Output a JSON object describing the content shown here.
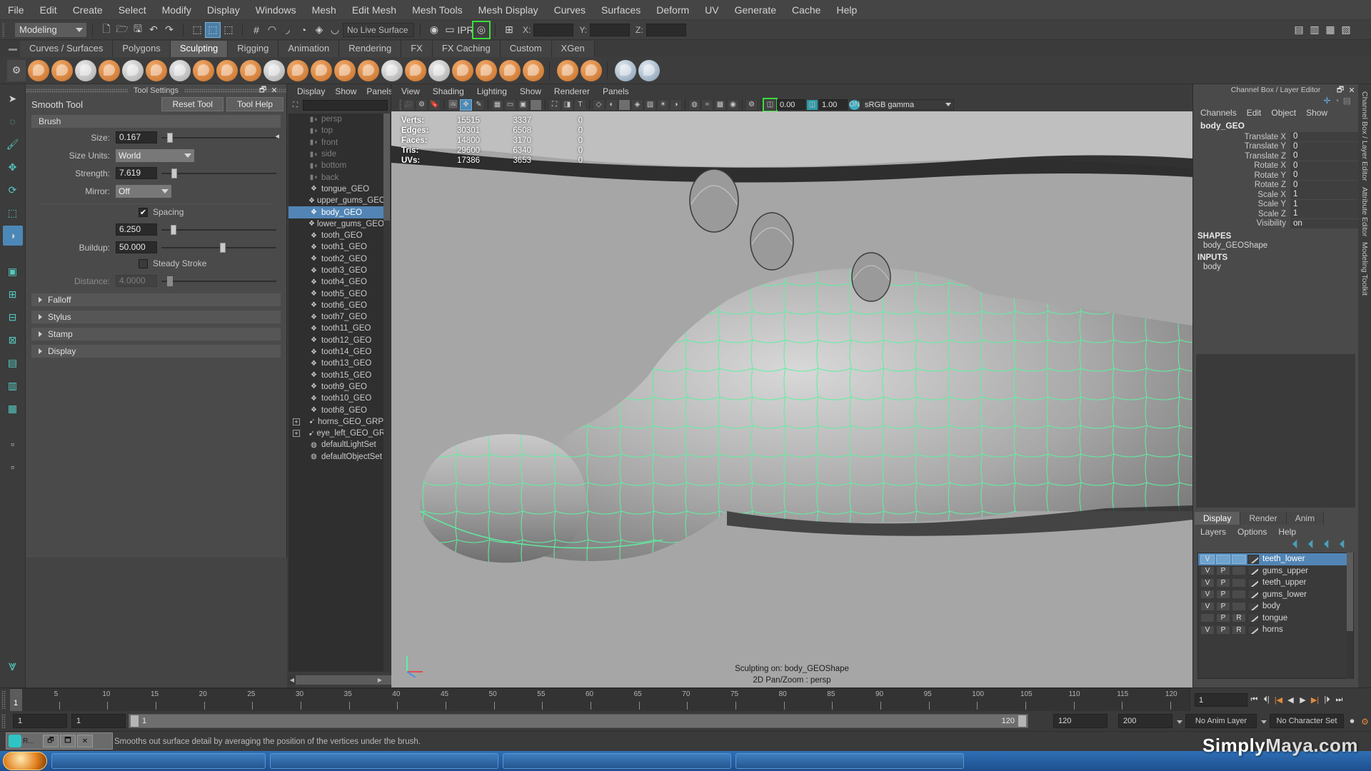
{
  "menubar": {
    "items": [
      "File",
      "Edit",
      "Create",
      "Select",
      "Modify",
      "Display",
      "Windows",
      "Mesh",
      "Edit Mesh",
      "Mesh Tools",
      "Mesh Display",
      "Curves",
      "Surfaces",
      "Deform",
      "UV",
      "Generate",
      "Cache",
      "Help"
    ]
  },
  "statusline": {
    "menuset": "Modeling",
    "live_surface": "No Live Surface",
    "coord_x_label": "X:",
    "coord_y_label": "Y:",
    "coord_z_label": "Z:"
  },
  "shelf": {
    "tabs": [
      "Curves / Surfaces",
      "Polygons",
      "Sculpting",
      "Rigging",
      "Animation",
      "Rendering",
      "FX",
      "FX Caching",
      "Custom",
      "XGen"
    ],
    "active_tab": "Sculpting"
  },
  "tool_settings": {
    "panel_title": "Tool Settings",
    "tool_name": "Smooth Tool",
    "reset_label": "Reset Tool",
    "help_label": "Tool Help",
    "brush_section": "Brush",
    "size_label": "Size:",
    "size_value": "0.167",
    "size_units_label": "Size Units:",
    "size_units_value": "World",
    "strength_label": "Strength:",
    "strength_value": "7.619",
    "mirror_label": "Mirror:",
    "mirror_value": "Off",
    "spacing_label": "Spacing",
    "spacing_checked": true,
    "spacing_value": "6.250",
    "buildup_label": "Buildup:",
    "buildup_value": "50.000",
    "steady_stroke_label": "Steady Stroke",
    "steady_stroke_checked": false,
    "distance_label": "Distance:",
    "distance_value": "4.0000",
    "collapsed_sections": [
      "Falloff",
      "Stylus",
      "Stamp",
      "Display"
    ]
  },
  "outliner": {
    "menu": [
      "Display",
      "Show",
      "Panels"
    ],
    "items": [
      {
        "label": "persp",
        "icon": "camera-icon",
        "dim": true,
        "plus": false
      },
      {
        "label": "top",
        "icon": "camera-icon",
        "dim": true,
        "plus": false
      },
      {
        "label": "front",
        "icon": "camera-icon",
        "dim": true,
        "plus": false
      },
      {
        "label": "side",
        "icon": "camera-icon",
        "dim": true,
        "plus": false
      },
      {
        "label": "bottom",
        "icon": "camera-icon",
        "dim": true,
        "plus": false
      },
      {
        "label": "back",
        "icon": "camera-icon",
        "dim": true,
        "plus": false
      },
      {
        "label": "tongue_GEO",
        "icon": "mesh-icon",
        "dim": false,
        "plus": false
      },
      {
        "label": "upper_gums_GEO",
        "icon": "mesh-icon",
        "dim": false,
        "plus": false
      },
      {
        "label": "body_GEO",
        "icon": "mesh-icon",
        "dim": false,
        "plus": false,
        "selected": true
      },
      {
        "label": "lower_gums_GEO",
        "icon": "mesh-icon",
        "dim": false,
        "plus": false
      },
      {
        "label": "tooth_GEO",
        "icon": "mesh-icon",
        "dim": false,
        "plus": false
      },
      {
        "label": "tooth1_GEO",
        "icon": "mesh-icon",
        "dim": false,
        "plus": false
      },
      {
        "label": "tooth2_GEO",
        "icon": "mesh-icon",
        "dim": false,
        "plus": false
      },
      {
        "label": "tooth3_GEO",
        "icon": "mesh-icon",
        "dim": false,
        "plus": false
      },
      {
        "label": "tooth4_GEO",
        "icon": "mesh-icon",
        "dim": false,
        "plus": false
      },
      {
        "label": "tooth5_GEO",
        "icon": "mesh-icon",
        "dim": false,
        "plus": false
      },
      {
        "label": "tooth6_GEO",
        "icon": "mesh-icon",
        "dim": false,
        "plus": false
      },
      {
        "label": "tooth7_GEO",
        "icon": "mesh-icon",
        "dim": false,
        "plus": false
      },
      {
        "label": "tooth11_GEO",
        "icon": "mesh-icon",
        "dim": false,
        "plus": false
      },
      {
        "label": "tooth12_GEO",
        "icon": "mesh-icon",
        "dim": false,
        "plus": false
      },
      {
        "label": "tooth14_GEO",
        "icon": "mesh-icon",
        "dim": false,
        "plus": false
      },
      {
        "label": "tooth13_GEO",
        "icon": "mesh-icon",
        "dim": false,
        "plus": false
      },
      {
        "label": "tooth15_GEO",
        "icon": "mesh-icon",
        "dim": false,
        "plus": false
      },
      {
        "label": "tooth9_GEO",
        "icon": "mesh-icon",
        "dim": false,
        "plus": false
      },
      {
        "label": "tooth10_GEO",
        "icon": "mesh-icon",
        "dim": false,
        "plus": false
      },
      {
        "label": "tooth8_GEO",
        "icon": "mesh-icon",
        "dim": false,
        "plus": false
      },
      {
        "label": "horns_GEO_GRP",
        "icon": "group-icon",
        "dim": false,
        "plus": true
      },
      {
        "label": "eye_left_GEO_GRP",
        "icon": "group-icon",
        "dim": false,
        "plus": true
      },
      {
        "label": "defaultLightSet",
        "icon": "set-icon",
        "dim": false,
        "plus": false
      },
      {
        "label": "defaultObjectSet",
        "icon": "set-icon",
        "dim": false,
        "plus": false
      }
    ]
  },
  "viewport": {
    "menu": [
      "View",
      "Shading",
      "Lighting",
      "Show",
      "Renderer",
      "Panels"
    ],
    "exposure_value": "0.00",
    "gamma_value": "1.00",
    "color_space": "sRGB gamma",
    "hud": {
      "rows": [
        {
          "key": "Verts:",
          "selected": "15515",
          "total": "3337",
          "third": "0"
        },
        {
          "key": "Edges:",
          "selected": "30301",
          "total": "6508",
          "third": "0"
        },
        {
          "key": "Faces:",
          "selected": "14800",
          "total": "3170",
          "third": "0"
        },
        {
          "key": "Tris:",
          "selected": "29600",
          "total": "6340",
          "third": "0"
        },
        {
          "key": "UVs:",
          "selected": "17386",
          "total": "3653",
          "third": "0"
        }
      ]
    },
    "status_line_1": "Sculpting on: body_GEOShape",
    "status_line_2": "2D Pan/Zoom : persp",
    "wireframe_color": "#5ef0a0"
  },
  "channelbox": {
    "panel_title": "Channel Box / Layer Editor",
    "menu": [
      "Channels",
      "Edit",
      "Object",
      "Show"
    ],
    "object_name": "body_GEO",
    "attributes": [
      {
        "name": "Translate X",
        "value": "0"
      },
      {
        "name": "Translate Y",
        "value": "0"
      },
      {
        "name": "Translate Z",
        "value": "0"
      },
      {
        "name": "Rotate X",
        "value": "0"
      },
      {
        "name": "Rotate Y",
        "value": "0"
      },
      {
        "name": "Rotate Z",
        "value": "0"
      },
      {
        "name": "Scale X",
        "value": "1"
      },
      {
        "name": "Scale Y",
        "value": "1"
      },
      {
        "name": "Scale Z",
        "value": "1"
      },
      {
        "name": "Visibility",
        "value": "on"
      }
    ],
    "shapes_label": "SHAPES",
    "shape_name": "body_GEOShape",
    "inputs_label": "INPUTS",
    "input_name": "body"
  },
  "layer_editor": {
    "tabs": [
      "Display",
      "Render",
      "Anim"
    ],
    "active_tab": "Display",
    "menu": [
      "Layers",
      "Options",
      "Help"
    ],
    "layers": [
      {
        "name": "teeth_lower",
        "v": "V",
        "p": "",
        "r": "",
        "selected": true
      },
      {
        "name": "gums_upper",
        "v": "V",
        "p": "P",
        "r": "",
        "selected": false
      },
      {
        "name": "teeth_upper",
        "v": "V",
        "p": "P",
        "r": "",
        "selected": false
      },
      {
        "name": "gums_lower",
        "v": "V",
        "p": "P",
        "r": "",
        "selected": false
      },
      {
        "name": "body",
        "v": "V",
        "p": "P",
        "r": "",
        "selected": false
      },
      {
        "name": "tongue",
        "v": "",
        "p": "P",
        "r": "R",
        "selected": false
      },
      {
        "name": "horns",
        "v": "V",
        "p": "P",
        "r": "R",
        "selected": false
      }
    ]
  },
  "right_tabs": [
    "Channel Box / Layer Editor",
    "Attribute Editor",
    "Modeling Toolkit"
  ],
  "timeline": {
    "ticks": [
      "5",
      "10",
      "15",
      "20",
      "25",
      "30",
      "35",
      "40",
      "45",
      "50",
      "55",
      "60",
      "65",
      "70",
      "75",
      "80",
      "85",
      "90",
      "95",
      "100",
      "105",
      "110",
      "115",
      "120"
    ],
    "current_frame": "1",
    "current_frame_field": "1"
  },
  "range_slider": {
    "start": "1",
    "end": "1",
    "range_start": "1",
    "range_end": "120",
    "playback_end": "120",
    "anim_end": "200",
    "anim_layer": "No Anim Layer",
    "character_set": "No Character Set"
  },
  "helpline": {
    "text": "Smooths out surface detail by averaging the position of the vertices under the brush."
  },
  "watermark": {
    "text_a": "Simply",
    "text_b": "Maya",
    "text_c": ".com"
  }
}
